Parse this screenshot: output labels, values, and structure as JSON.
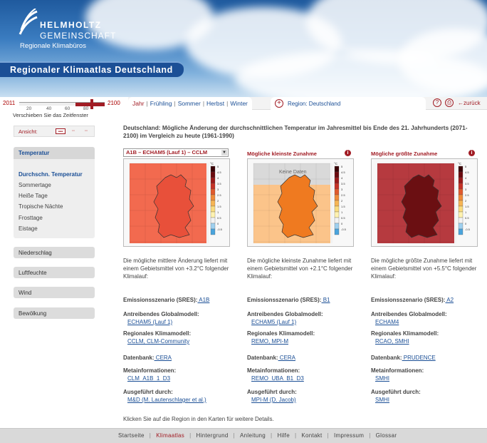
{
  "header": {
    "logo_line1": "HELMHOLTZ",
    "logo_line2": "GEMEINSCHAFT",
    "office": "Regionale Klimabüros",
    "title": "Regionaler Klimaatlas Deutschland"
  },
  "timeline": {
    "start": "2011",
    "end": "2100",
    "ticks": [
      "20",
      "40",
      "60",
      "80"
    ],
    "caption": "Verschieben Sie das Zeitfenster",
    "window_start_fraction": 0.66,
    "window_end_fraction": 1.0
  },
  "seasons": {
    "items": [
      "Jahr",
      "Frühling",
      "Sommer",
      "Herbst",
      "Winter"
    ],
    "active": "Jahr"
  },
  "region_tab": {
    "label": "Region: Deutschland"
  },
  "toolbar": {
    "help": "?",
    "back": "zurück"
  },
  "sidebar": {
    "view_label": "Ansicht:",
    "temperature_head": "Temperatur",
    "temperature_items": [
      "Durchschn. Temperatur",
      "Sommertage",
      "Heiße Tage",
      "Tropische Nächte",
      "Frosttage",
      "Eistage"
    ],
    "buttons": [
      "Niederschlag",
      "Luftfeuchte",
      "Wind",
      "Bewölkung"
    ]
  },
  "main": {
    "title": "Deutschland: Mögliche Änderung der durchschnittlichen Temperatur im Jahresmittel bis Ende des 21. Jahrhunderts (2071-2100) im Vergleich zu heute (1961-1990)",
    "footnote": "Klicken Sie auf die Region in den Karten für weitere Details.",
    "labels": {
      "scenario": "Emissionsszenario (SRES):",
      "global": "Antreibendes Globalmodell:",
      "regional": "Regionales Klimamodell:",
      "database": "Datenbank:",
      "meta": "Metainformationen:",
      "executed": "Ausgeführt durch:"
    },
    "columns": [
      {
        "header": "A1B – ECHAM5 (Lauf 1) – CCLM",
        "desc": "Die mögliche mittlere Änderung liefert mit einem Gebietsmittel von +3.2°C folgender Klimalauf:",
        "scenario": "A1B",
        "global": "ECHAM5 (Lauf 1)",
        "regional": "CCLM, CLM-Community",
        "database": "CERA",
        "meta": "CLM_A1B_1_D3",
        "executed": "M&D (M. Lautenschlager et al.)",
        "map_fill": "#e8503a",
        "map_bg": "#f26a4f",
        "no_data": ""
      },
      {
        "header": "Mögliche kleinste Zunahme",
        "desc": "Die mögliche kleinste Zunahme liefert mit einem Gebietsmittel von +2.1°C folgender Klimalauf:",
        "scenario": "B1",
        "global": "ECHAM5 (Lauf 1)",
        "regional": "REMO, MPI-M",
        "database": "CERA",
        "meta": "REMO_UBA_B1_D3",
        "executed": "MPI-M (D. Jacob)",
        "map_fill": "#ef7a20",
        "map_bg": "#fbc48a",
        "no_data": "Keine Daten"
      },
      {
        "header": "Mögliche größte Zunahme",
        "desc": "Die mögliche größte Zunahme liefert mit einem Gebietsmittel von +5.5°C folgender Klimalauf:",
        "scenario": "A2",
        "global": "ECHAM4",
        "regional": "RCAO, SMHI",
        "database": "PRUDENCE",
        "meta": "SMHI",
        "executed": "SMHI",
        "map_fill": "#6b0f12",
        "map_bg": "#b63a3f",
        "no_data": ""
      }
    ],
    "legend_unit": "°C",
    "legend_ticks": [
      "5",
      "4.5",
      "4",
      "3.5",
      "3",
      "2.5",
      "2",
      "1.5",
      "1",
      "0.5",
      "0",
      "-0.5"
    ]
  },
  "footer": {
    "items": [
      "Startseite",
      "Klimaatlas",
      "Hintergrund",
      "Anleitung",
      "Hilfe",
      "Kontakt",
      "Impressum",
      "Glossar"
    ],
    "active": "Klimaatlas"
  }
}
